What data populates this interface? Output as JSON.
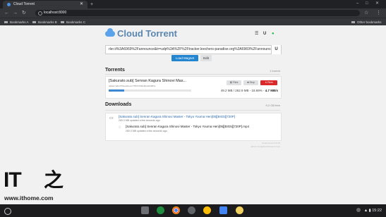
{
  "browser": {
    "tab_title": "Cloud Torrent",
    "new_tab": "+",
    "url": "localhost:8000",
    "bookmarks": [
      "Bookmarks A",
      "Bookmarks B",
      "Bookmarks C"
    ],
    "other_bookmarks": "Other bookmarks"
  },
  "app": {
    "title": "Cloud Torrent",
    "magnet_value": "rler.ti%3A6969%2Fannounce&tr=udp%3A%2F%2Ftracker.leechers-paradise.org%3A6969%2Fannounce",
    "load_label": "Load Magnet",
    "edit_label": "Edit"
  },
  "torrents": {
    "heading": "Torrents",
    "count": "1 torrent",
    "items": [
      {
        "name": "[Sakurato.sub] Senran Kagura Shinovi Mas...",
        "hash": "da9ac7e8e4794ea2dece7786b7bb8e8d4e84984e",
        "files_label": "Files",
        "stop_label": "Stop",
        "remove_label": "Rem",
        "progress": 0.1869,
        "size_text": "49.2 MB / 262.9 MB - 18.69% -",
        "rate_text": "4.7 MB/s"
      }
    ]
  },
  "downloads": {
    "heading": "Downloads",
    "free": "9.2 GB free",
    "folder": {
      "name": "[Sakurato.sub] Senran Kagura Shinovi Master - Tokyo Youma Hen[05][BIG5][720P]",
      "sub": "260.3 MB updated a few seconds ago"
    },
    "file": {
      "name": "[Sakurato.sub] Senran Kagura Shinovi Master - Tokyo Youma Hen[05][BIG5][720P].mp4",
      "sub": "260.3 MB updated a few seconds ago"
    }
  },
  "footer": {
    "line1": "cloud-torrent 0.8.25",
    "line2": "github.com/jpillora/cloud-torrent"
  },
  "watermark": {
    "logo": "IT之家",
    "url": "www.ithome.com"
  },
  "shelf": {
    "time": "15:22"
  }
}
